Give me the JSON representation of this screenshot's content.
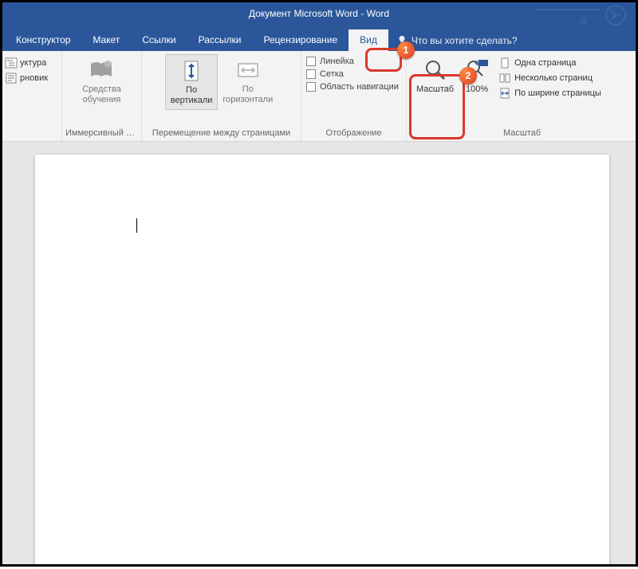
{
  "title": "Документ Microsoft Word  -  Word",
  "tabs": {
    "konstruktor": "Конструктор",
    "maket": "Макет",
    "ssylki": "Ссылки",
    "rassylki": "Рассылки",
    "review": "Рецензирование",
    "vid": "Вид",
    "tell_me": "Что вы хотите сделать?"
  },
  "views_group": {
    "label": "Иммерсивный ре…",
    "items": {
      "struktura": "уктура",
      "chernovik": "рновик",
      "tools": "Средства\nобучения"
    }
  },
  "nav_group": {
    "label": "Перемещение между страницами",
    "vertical": "По\nвертикали",
    "horizontal": "По\nгоризонтали"
  },
  "show_group": {
    "label": "Отображение",
    "ruler": "Линейка",
    "grid": "Сетка",
    "navpane": "Область навигации"
  },
  "zoom_group": {
    "label": "Масштаб",
    "zoom": "Масштаб",
    "pct": "100%",
    "one_page": "Одна страница",
    "multi_page": "Несколько страниц",
    "page_width": "По ширине страницы"
  },
  "badges": {
    "one": "1",
    "two": "2"
  }
}
